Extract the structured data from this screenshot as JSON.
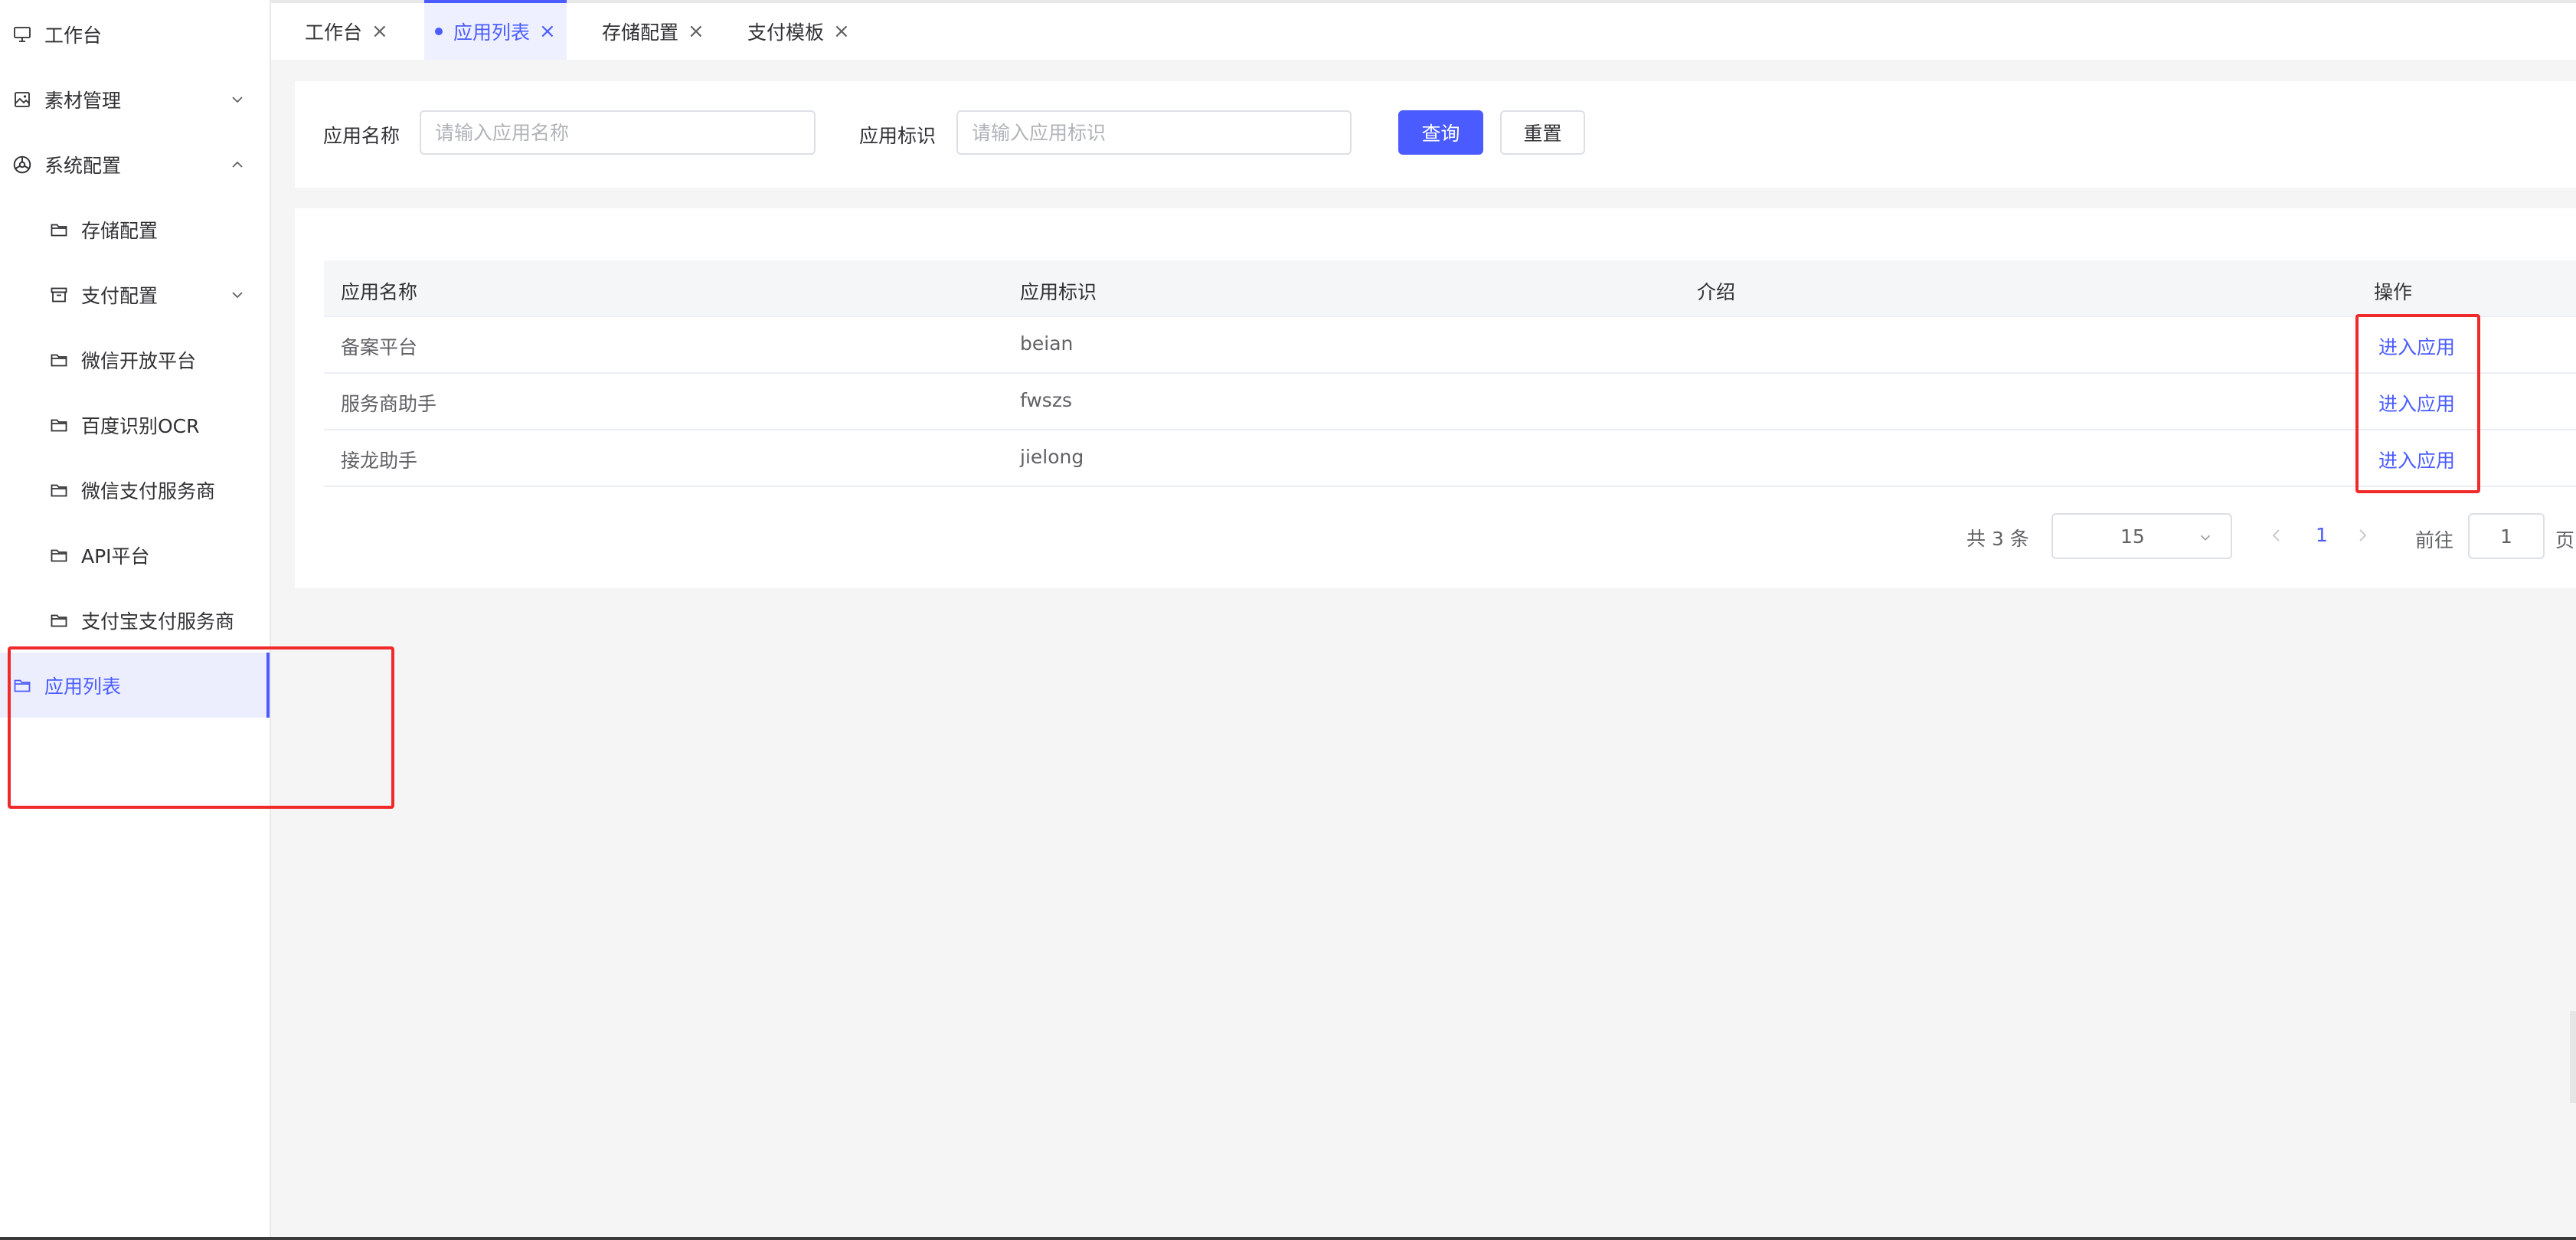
{
  "sidebar": {
    "items": [
      {
        "label": "工作台",
        "icon": "monitor-icon",
        "level": 1
      },
      {
        "label": "素材管理",
        "icon": "image-icon",
        "level": 1,
        "expandable": true,
        "expanded": false
      },
      {
        "label": "系统配置",
        "icon": "system-icon",
        "level": 1,
        "expandable": true,
        "expanded": true
      },
      {
        "label": "存储配置",
        "icon": "folder-icon",
        "level": 2
      },
      {
        "label": "支付配置",
        "icon": "archive-icon",
        "level": 2,
        "expandable": true,
        "expanded": false
      },
      {
        "label": "微信开放平台",
        "icon": "folder-icon",
        "level": 2
      },
      {
        "label": "百度识别OCR",
        "icon": "folder-icon",
        "level": 2
      },
      {
        "label": "微信支付服务商",
        "icon": "folder-icon",
        "level": 2
      },
      {
        "label": "API平台",
        "icon": "folder-icon",
        "level": 2
      },
      {
        "label": "支付宝支付服务商",
        "icon": "folder-icon",
        "level": 2
      },
      {
        "label": "应用列表",
        "icon": "folder-icon",
        "level": 1,
        "active": true
      }
    ]
  },
  "tabs": [
    {
      "label": "工作台",
      "active": false
    },
    {
      "label": "应用列表",
      "active": true
    },
    {
      "label": "存储配置",
      "active": false
    },
    {
      "label": "支付模板",
      "active": false
    }
  ],
  "search": {
    "name_label": "应用名称",
    "name_placeholder": "请输入应用名称",
    "name_value": "",
    "key_label": "应用标识",
    "key_placeholder": "请输入应用标识",
    "key_value": "",
    "query_button": "查询",
    "reset_button": "重置"
  },
  "table": {
    "columns": [
      "应用名称",
      "应用标识",
      "介绍",
      "操作"
    ],
    "rows": [
      {
        "name": "备案平台",
        "key": "beian",
        "intro": "",
        "action": "进入应用"
      },
      {
        "name": "服务商助手",
        "key": "fwszs",
        "intro": "",
        "action": "进入应用"
      },
      {
        "name": "接龙助手",
        "key": "jielong",
        "intro": "",
        "action": "进入应用"
      }
    ]
  },
  "pagination": {
    "total_text": "共 3 条",
    "page_size": "15",
    "current_page": "1",
    "goto_label": "前往",
    "goto_value": "1",
    "page_suffix": "页"
  },
  "colors": {
    "accent": "#4a5cff",
    "annotation": "#f02a2a",
    "active_bg": "#eceefe"
  }
}
